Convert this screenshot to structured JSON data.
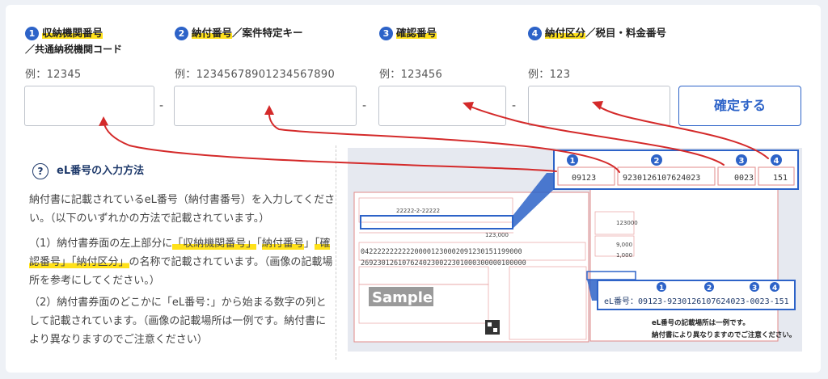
{
  "fields": [
    {
      "num": "1",
      "title": "収納機関番号",
      "subtitle": "／共通納税機関コード",
      "example": "例：12345"
    },
    {
      "num": "2",
      "title": "納付番号",
      "title_rest": "／案件特定キー",
      "example": "例：12345678901234567890"
    },
    {
      "num": "3",
      "title": "確認番号",
      "example": "例：123456"
    },
    {
      "num": "4",
      "title": "納付区分",
      "title_rest": "／税目・料金番号",
      "example": "例：123"
    }
  ],
  "dash": "-",
  "confirm_label": "確定する",
  "help": {
    "icon": "?",
    "title": "eL番号の入力方法",
    "p1": "納付書に記載されているeL番号（納付書番号）を入力してください。（以下のいずれかの方法で記載されています。）",
    "p2_a": "（1）納付書券面の左上部分に",
    "p2_h1": "「収納機関番号」",
    "p2_b": "「",
    "p2_h2": "納付番号",
    "p2_c": "」",
    "p2_h3": "「確認番号」",
    "p2_h4": "「納付区分」",
    "p2_d": "の名称で記載されています。（画像の記載場所を参考にしてください。）",
    "p3": "（2）納付書券面のどこかに「eL番号：」から始まる数字の列として記載されています。（画像の記載場所は一例です。納付書により異なりますのでご注意ください）"
  },
  "doc": {
    "strip_values": [
      "09123",
      "9230126107624023",
      "0023",
      "151"
    ],
    "el_label": "eL番号：09123-9230126107624023-0023-151",
    "note1": "eL番号の記載場所は一例です。",
    "note2": "納付書により異なりますのでご注意ください。",
    "sample": "Sample",
    "badges": [
      "1",
      "2",
      "3",
      "4"
    ],
    "long_num1": "042222222222200001230002091230151199000",
    "long_num2": "2692301261076240230022301000300000100000",
    "amount": "123,000",
    "code1": "22222-2-22222",
    "code2": "123000",
    "code3": "9,000",
    "code4": "1,000"
  },
  "colors": {
    "accent": "#2d63c8",
    "arrow": "#d42a2a",
    "highlight": "#ffe11a",
    "doc_red": "#e07070"
  }
}
